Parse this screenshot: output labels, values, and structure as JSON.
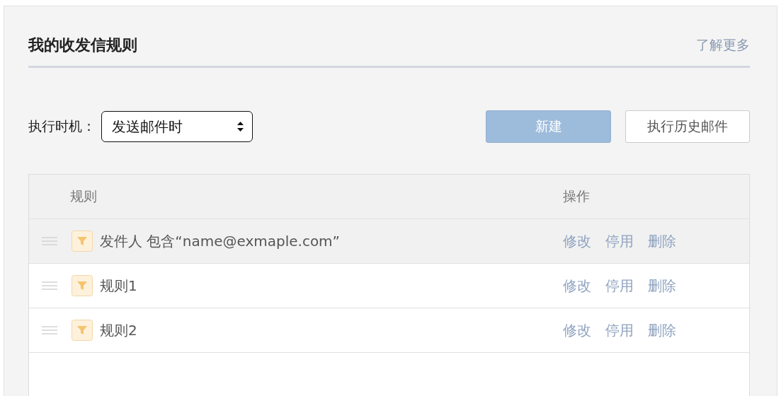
{
  "title": "我的收发信规则",
  "learn_more": "了解更多",
  "timing": {
    "label": "执行时机：",
    "value": "发送邮件时"
  },
  "buttons": [
    {
      "label": "新建",
      "kind": "primary"
    },
    {
      "label": "执行历史邮件",
      "kind": "default"
    }
  ],
  "table": {
    "columns": [
      "规则",
      "操作"
    ],
    "rows": [
      {
        "rule": "发件人 包含“name@exmaple.com”",
        "selected": true,
        "actions": [
          "修改",
          "停用",
          "删除"
        ]
      },
      {
        "rule": "规则1",
        "selected": false,
        "actions": [
          "修改",
          "停用",
          "删除"
        ]
      },
      {
        "rule": "规则2",
        "selected": false,
        "actions": [
          "修改",
          "停用",
          "删除"
        ]
      }
    ]
  }
}
